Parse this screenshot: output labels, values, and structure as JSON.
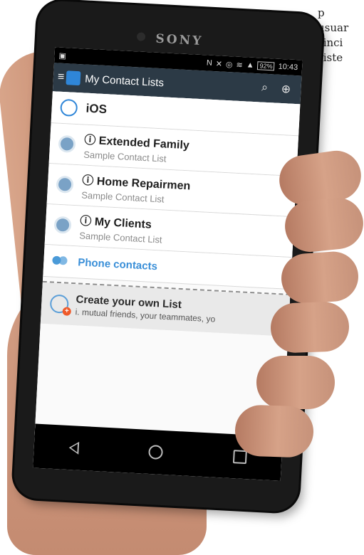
{
  "background_text": [
    "p",
    "usuar",
    "sinci",
    "siste"
  ],
  "device": {
    "brand": "SONY"
  },
  "statusbar": {
    "battery": "92%",
    "time": "10:43"
  },
  "appbar": {
    "title": "My Contact Lists"
  },
  "ios": {
    "label": "iOS"
  },
  "contacts": [
    {
      "name": "Extended Family",
      "subtitle": "Sample Contact List"
    },
    {
      "name": "Home Repairmen",
      "subtitle": "Sample Contact List"
    },
    {
      "name": "My Clients",
      "subtitle": "Sample Contact List"
    }
  ],
  "phone_contacts": {
    "label": "Phone contacts"
  },
  "create_list": {
    "title": "Create your own List",
    "subtitle": "i. mutual friends, your teammates, yo"
  },
  "colors": {
    "accent": "#2f86d8",
    "appbar": "#2c3a46",
    "phone_link": "#3a8fd8",
    "plus_badge": "#ef5a2a"
  }
}
